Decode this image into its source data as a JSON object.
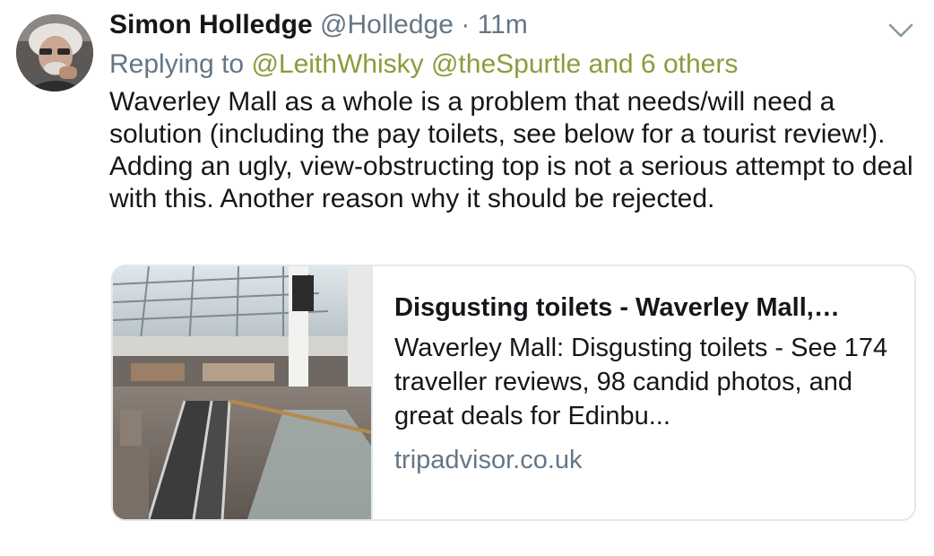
{
  "tweet": {
    "author_name": "Simon Holledge",
    "author_handle": "@Holledge",
    "separator": "·",
    "timestamp": "11m",
    "replying_prefix": "Replying to",
    "mentions": [
      "@LeithWhisky",
      "@theSpurtle"
    ],
    "others": "and 6 others",
    "text": "Waverley Mall as a whole is a problem that needs/will need a solution (including the pay toilets, see below for a tourist review!). Adding an ugly, view-obstructing top is not a serious attempt to deal with this. Another reason why it should be rejected.",
    "menu_icon": "chevron-down-icon"
  },
  "card": {
    "title": "Disgusting toilets - Waverley Mall,…",
    "description": "Waverley Mall: Disgusting toilets - See 174 traveller reviews, 98 candid photos, and great deals for Edinbu...",
    "domain": "tripadvisor.co.uk"
  },
  "colors": {
    "text": "#14171a",
    "secondary": "#657786",
    "mention": "#8d9b3c",
    "border": "#e1e8ed"
  }
}
